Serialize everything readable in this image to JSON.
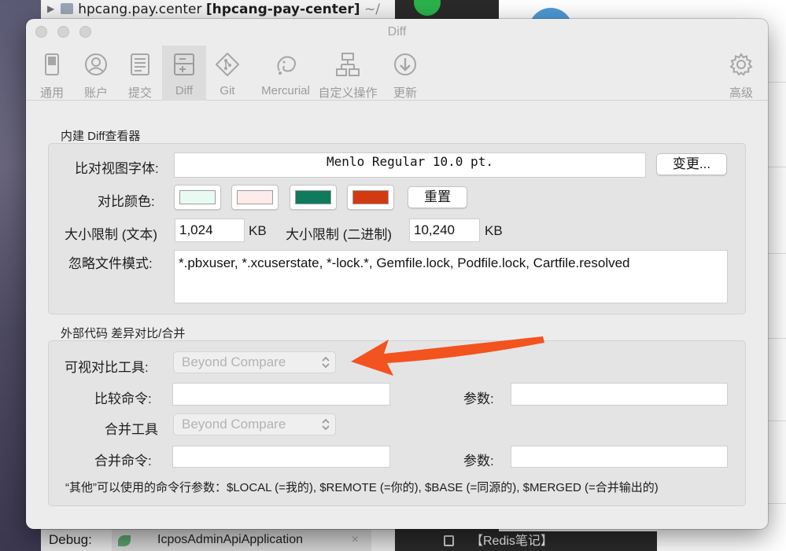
{
  "background": {
    "project_name": "hpcang.pay.center",
    "project_module": "[hpcang-pay-center]",
    "project_path_prefix": "~/",
    "debug_label": "Debug:",
    "run_config": "IcposAdminApiApplication",
    "run_close": "×",
    "note_tab": "【Redis笔记】"
  },
  "window": {
    "title": "Diff"
  },
  "toolbar": {
    "items": [
      {
        "label": "通用",
        "icon": "switch-icon"
      },
      {
        "label": "账户",
        "icon": "account-icon"
      },
      {
        "label": "提交",
        "icon": "commit-icon"
      },
      {
        "label": "Diff",
        "icon": "diff-icon",
        "selected": true
      },
      {
        "label": "Git",
        "icon": "git-icon"
      },
      {
        "label": "Mercurial",
        "icon": "mercurial-icon"
      },
      {
        "label": "自定义操作",
        "icon": "custom-actions-icon"
      },
      {
        "label": "更新",
        "icon": "update-icon"
      },
      {
        "label": "高级",
        "icon": "gear-icon"
      }
    ]
  },
  "builtin": {
    "title": "内建 Diff查看器",
    "font_label": "比对视图字体:",
    "font_value": "Menlo Regular 10.0 pt.",
    "change_button": "变更...",
    "color_label": "对比颜色:",
    "colors": [
      "#e8fbf3",
      "#fdece9",
      "#0f7a5c",
      "#d23b11"
    ],
    "reset_button": "重置",
    "size_text_label": "大小限制 (文本)",
    "size_text_value": "1,024",
    "size_text_unit": "KB",
    "size_binary_label": "大小限制 (二进制)",
    "size_binary_value": "10,240",
    "size_binary_unit": "KB",
    "ignore_label": "忽略文件模式:",
    "ignore_value": "*.pbxuser, *.xcuserstate, *-lock.*, Gemfile.lock, Podfile.lock, Cartfile.resolved"
  },
  "external": {
    "title": "外部代码 差异对比/合并",
    "visual_tool_label": "可视对比工具:",
    "visual_tool_value": "Beyond Compare",
    "compare_cmd_label": "比较命令:",
    "compare_cmd_value": "",
    "compare_args_label": "参数:",
    "compare_args_value": "",
    "merge_tool_label": "合并工具",
    "merge_tool_value": "Beyond Compare",
    "merge_cmd_label": "合并命令:",
    "merge_cmd_value": "",
    "merge_args_label": "参数:",
    "merge_args_value": "",
    "note": "“其他”可以使用的命令行参数：$LOCAL (=我的), $REMOTE (=你的), $BASE (=同源的), $MERGED (=合并输出的)"
  },
  "annotation": {
    "arrow_color": "#f2531f"
  }
}
